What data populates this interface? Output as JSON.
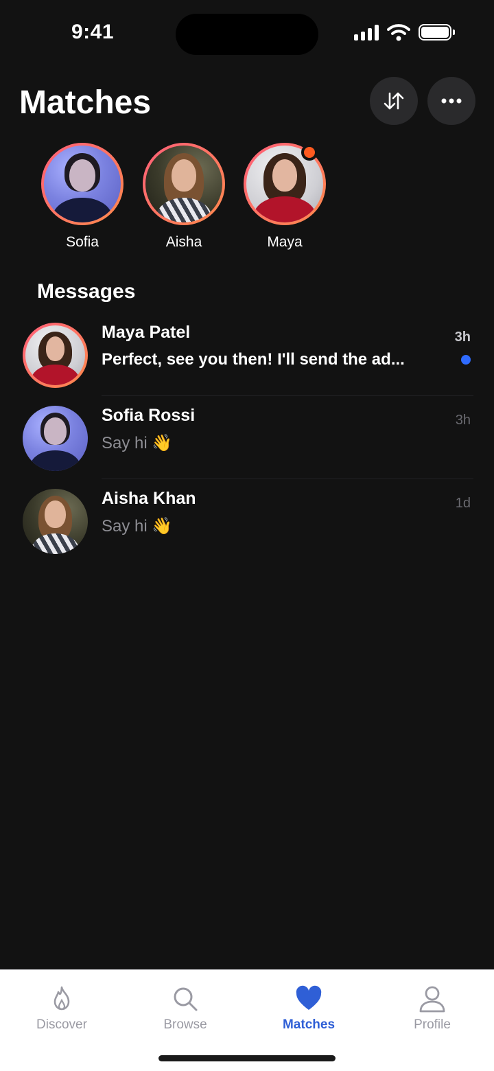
{
  "status_bar": {
    "time": "9:41"
  },
  "header": {
    "title": "Matches",
    "sort_icon": "sort-arrows-icon",
    "more_icon": "more-horizontal-icon"
  },
  "matches": [
    {
      "name": "Sofia",
      "online": false
    },
    {
      "name": "Aisha",
      "online": false
    },
    {
      "name": "Maya",
      "online": true
    }
  ],
  "messages": {
    "title": "Messages",
    "items": [
      {
        "name": "Maya Patel",
        "preview": "Perfect, see you then! I'll send the ad...",
        "time": "3h",
        "unread": true
      },
      {
        "name": "Sofia Rossi",
        "preview": "Say hi 👋",
        "time": "3h",
        "unread": false
      },
      {
        "name": "Aisha Khan",
        "preview": "Say hi 👋",
        "time": "1d",
        "unread": false
      }
    ]
  },
  "tabs": [
    {
      "label": "Discover",
      "icon": "flame-icon",
      "active": false
    },
    {
      "label": "Browse",
      "icon": "search-icon",
      "active": false
    },
    {
      "label": "Matches",
      "icon": "heart-icon",
      "active": true
    },
    {
      "label": "Profile",
      "icon": "user-icon",
      "active": false
    }
  ],
  "colors": {
    "background": "#121212",
    "accent": "#2f5fd6",
    "story_ring": "#ff5f79",
    "online_dot": "#ff5a1f",
    "unread_dot": "#2f6bff"
  }
}
